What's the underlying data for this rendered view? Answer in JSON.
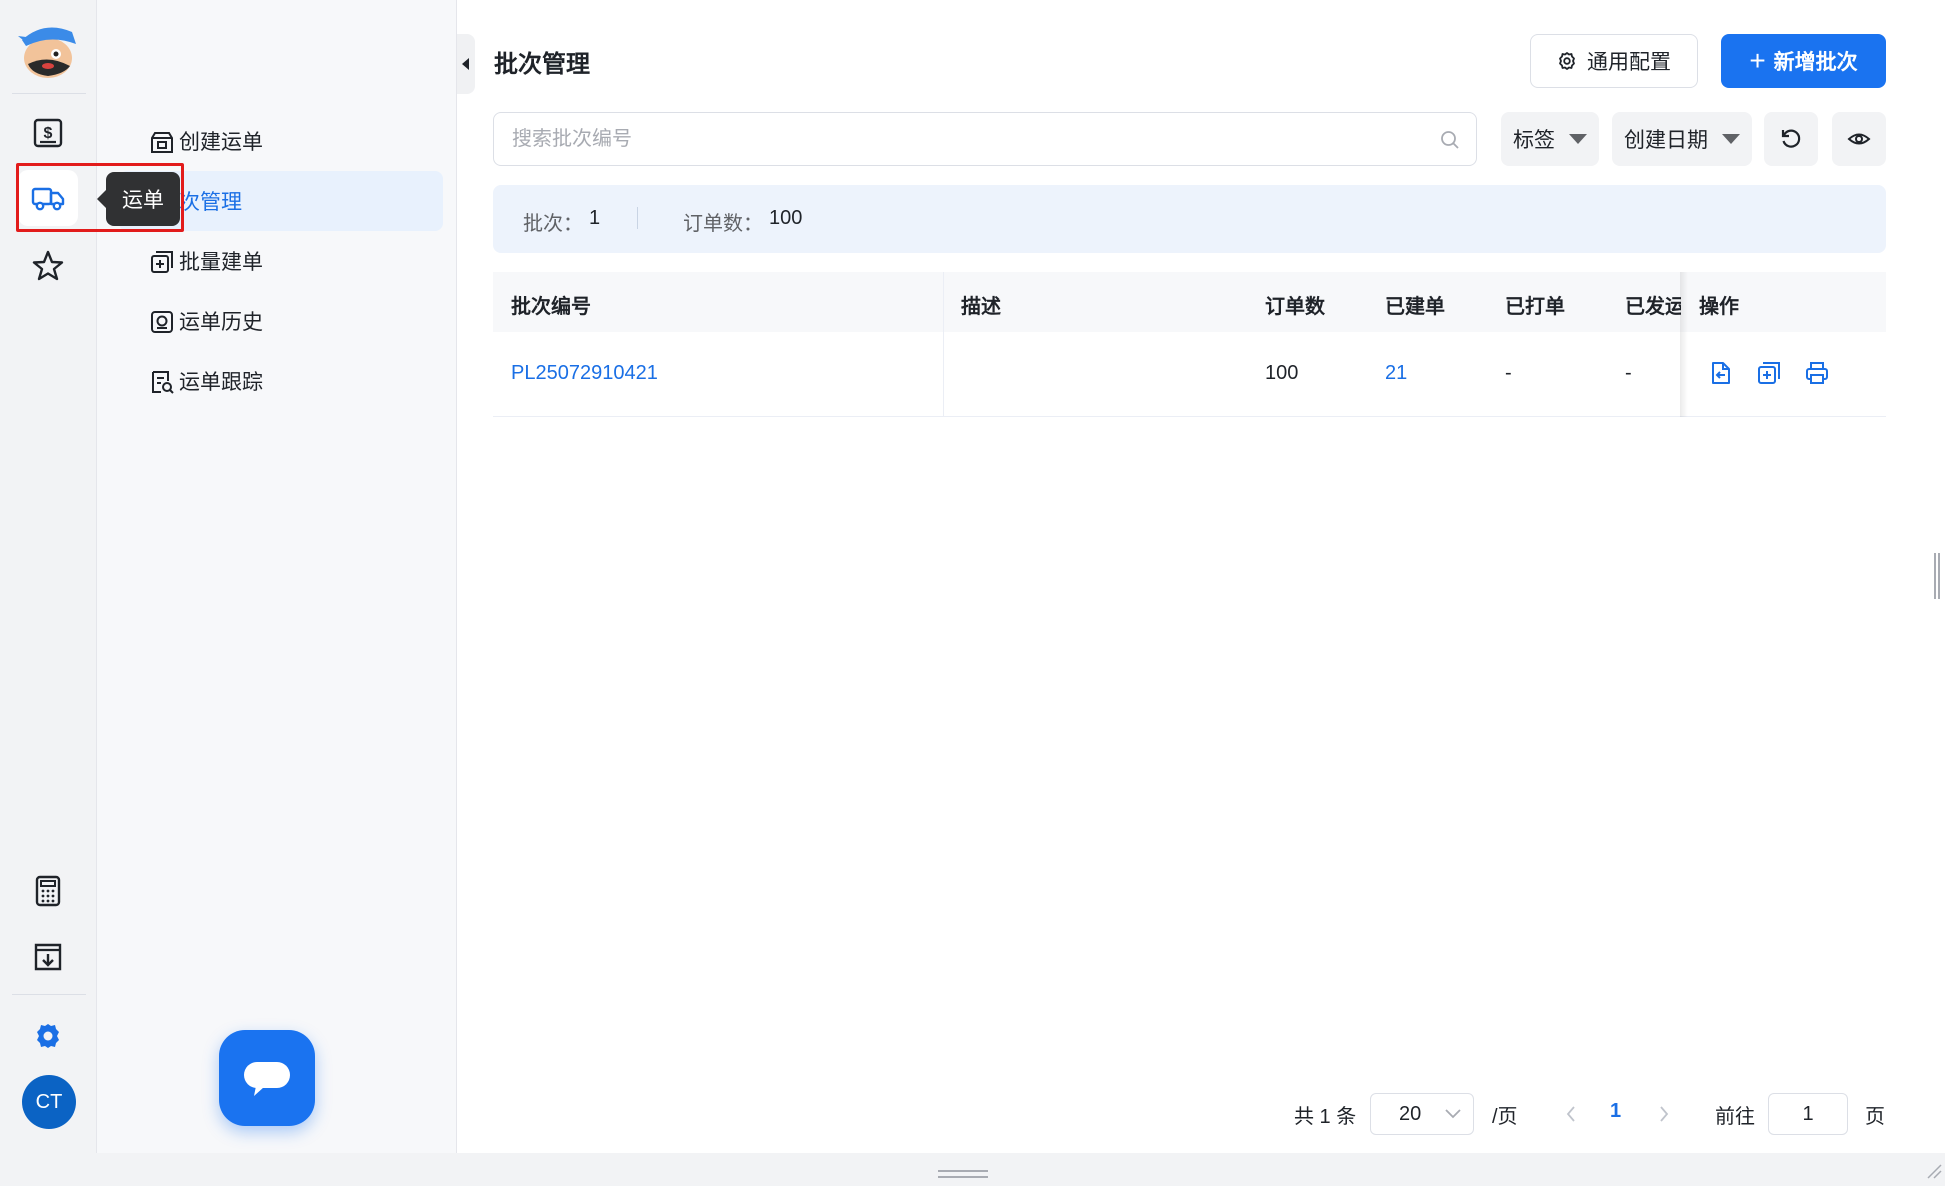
{
  "rail": {
    "tooltip": "运单",
    "avatar_initials": "CT",
    "icons": [
      "billing-icon",
      "truck-icon",
      "star-icon",
      "calculator-icon",
      "download-box-icon",
      "gear-icon"
    ]
  },
  "submenu": {
    "items": [
      {
        "label": "创建运单",
        "icon": "package-icon"
      },
      {
        "label": "批次管理",
        "icon": "batch-icon",
        "active": true
      },
      {
        "label": "批量建单",
        "icon": "bulk-add-icon"
      },
      {
        "label": "运单历史",
        "icon": "history-icon"
      },
      {
        "label": "运单跟踪",
        "icon": "tracking-icon"
      }
    ],
    "active_visible_label": "次管理"
  },
  "header": {
    "title": "批次管理",
    "config_button": "通用配置",
    "add_button": "新增批次"
  },
  "search": {
    "placeholder": "搜索批次编号"
  },
  "filters": {
    "tag": "标签",
    "created_date": "创建日期"
  },
  "stats": {
    "batch_label": "批次：",
    "batch_value": "1",
    "orders_label": "订单数：",
    "orders_value": "100"
  },
  "table": {
    "columns": [
      "批次编号",
      "描述",
      "订单数",
      "已建单",
      "已打单",
      "已发运",
      "操作"
    ],
    "rows": [
      {
        "batch_no": "PL25072910421",
        "description": "",
        "orders": "100",
        "created": "21",
        "printed": "-",
        "shipped": "-"
      }
    ]
  },
  "pagination": {
    "total": "共 1 条",
    "page_size": "20",
    "per_page": "/页",
    "current_page": "1",
    "goto_label": "前往",
    "goto_value": "1",
    "page_suffix": "页"
  },
  "colors": {
    "primary": "#1a73f0",
    "link": "#1a6fe5",
    "highlight_box": "#e21b1b",
    "avatar": "#0b63c4"
  }
}
